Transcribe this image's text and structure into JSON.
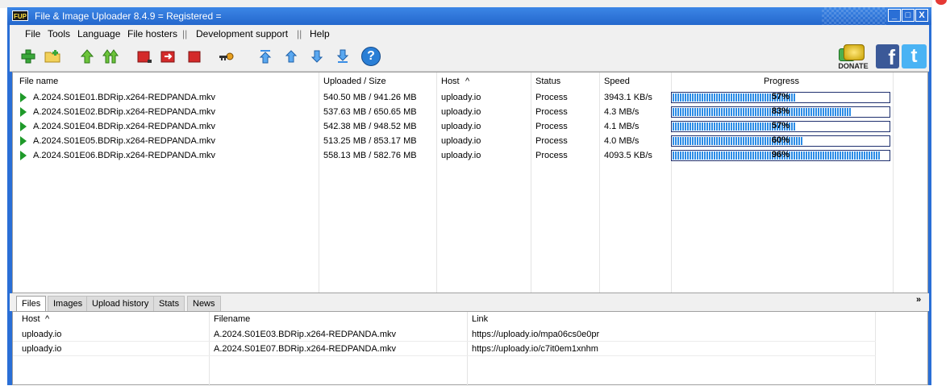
{
  "window": {
    "app_icon_text": "FUP",
    "title": "File & Image Uploader 8.4.9  = Registered =",
    "minimize": "_",
    "maximize": "□",
    "close": "X"
  },
  "menu": {
    "items": [
      "File",
      "Tools",
      "Language",
      "File hosters",
      "Development support",
      "Help"
    ],
    "separator": "||"
  },
  "toolbar": {
    "icons": [
      "add-files-icon",
      "add-folder-icon",
      "upload-icon",
      "upload-all-icon",
      "stop-icon",
      "stop-all-icon",
      "remove-icon",
      "key-icon",
      "move-top-icon",
      "move-up-icon",
      "move-down-icon",
      "move-bottom-icon",
      "help-icon"
    ],
    "help_glyph": "?",
    "donate_label": "DONATE",
    "facebook_glyph": "f",
    "twitter_glyph": "t",
    "colors": {
      "green": "#3aa83a",
      "red": "#d42a2a",
      "blue": "#3a8ee6",
      "help": "#2a7fd6"
    }
  },
  "uploads": {
    "columns": [
      "File name",
      "Uploaded / Size",
      "Host",
      "Status",
      "Speed",
      "Progress"
    ],
    "sort_indicator": "^",
    "rows": [
      {
        "file": "A.2024.S01E01.BDRip.x264-REDPANDA.mkv",
        "uploaded": "540.50 MB / 941.26 MB",
        "host": "uploady.io",
        "status": "Process",
        "speed": "3943.1 KB/s",
        "progress": 57,
        "progress_label": "57%"
      },
      {
        "file": "A.2024.S01E02.BDRip.x264-REDPANDA.mkv",
        "uploaded": "537.63 MB / 650.65 MB",
        "host": "uploady.io",
        "status": "Process",
        "speed": "4.3 MB/s",
        "progress": 83,
        "progress_label": "83%"
      },
      {
        "file": "A.2024.S01E04.BDRip.x264-REDPANDA.mkv",
        "uploaded": "542.38 MB / 948.52 MB",
        "host": "uploady.io",
        "status": "Process",
        "speed": "4.1 MB/s",
        "progress": 57,
        "progress_label": "57%"
      },
      {
        "file": "A.2024.S01E05.BDRip.x264-REDPANDA.mkv",
        "uploaded": "513.25 MB / 853.17 MB",
        "host": "uploady.io",
        "status": "Process",
        "speed": "4.0 MB/s",
        "progress": 60,
        "progress_label": "60%"
      },
      {
        "file": "A.2024.S01E06.BDRip.x264-REDPANDA.mkv",
        "uploaded": "558.13 MB / 582.76 MB",
        "host": "uploady.io",
        "status": "Process",
        "speed": "4093.5 KB/s",
        "progress": 96,
        "progress_label": "96%"
      }
    ]
  },
  "tabs": {
    "items": [
      "Files",
      "Images",
      "Upload history",
      "Stats",
      "News"
    ],
    "active": "Files",
    "collapse_glyph": "»"
  },
  "links": {
    "columns": [
      "Host",
      "Filename",
      "Link"
    ],
    "sort_indicator": "^",
    "rows": [
      {
        "host": "uploady.io",
        "filename": "A.2024.S01E03.BDRip.x264-REDPANDA.mkv",
        "link": "https://uploady.io/mpa06cs0e0pr"
      },
      {
        "host": "uploady.io",
        "filename": "A.2024.S01E07.BDRip.x264-REDPANDA.mkv",
        "link": "https://uploady.io/c7it0em1xnhm"
      }
    ]
  }
}
